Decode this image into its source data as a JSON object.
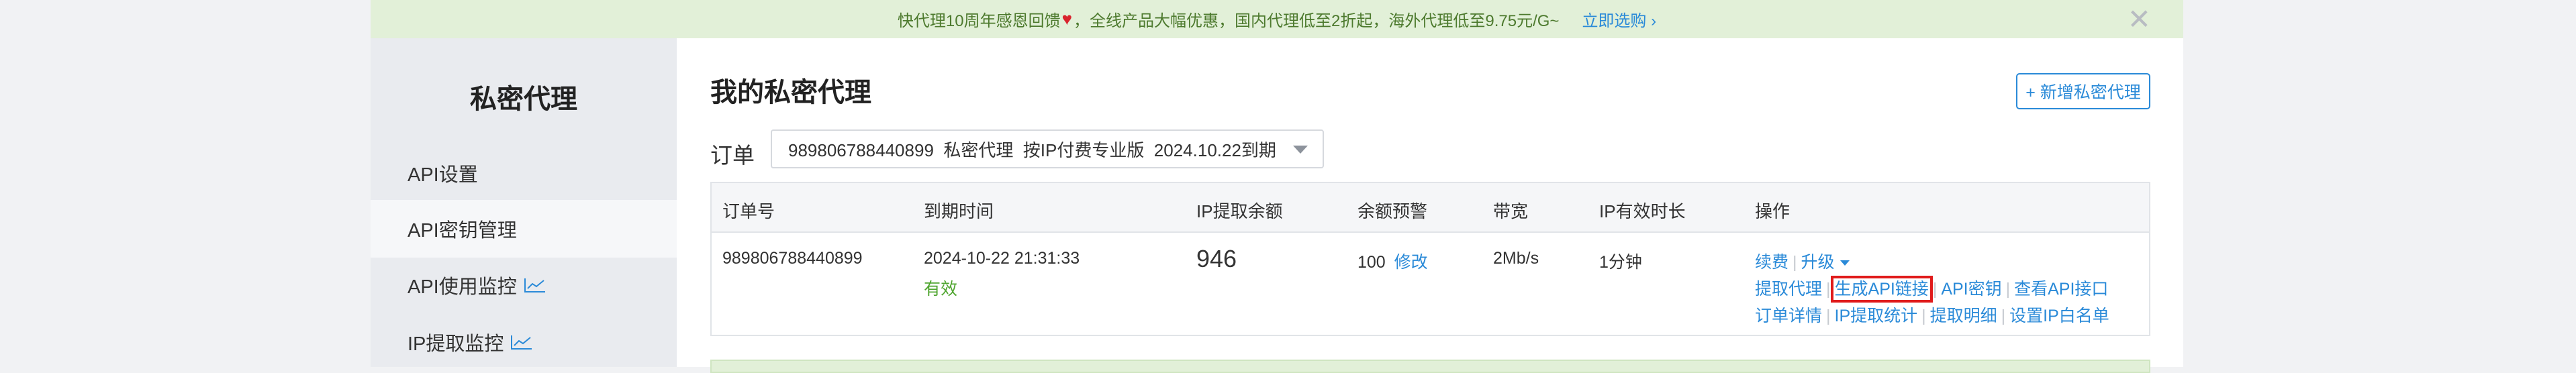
{
  "banner": {
    "text_before": "快代理10周年感恩回馈",
    "text_after": "，全线产品大幅优惠，国内代理低至2折起，海外代理低至9.75元/G~",
    "cta": "立即选购 ›",
    "close": "✕"
  },
  "sidebar": {
    "title": "私密代理",
    "items": [
      {
        "label": "API设置"
      },
      {
        "label": "API密钥管理"
      },
      {
        "label": "API使用监控"
      },
      {
        "label": "IP提取监控"
      }
    ]
  },
  "main": {
    "title": "我的私密代理",
    "add_button": "+ 新增私密代理",
    "order_label": "订单",
    "order_select": "989806788440899  私密代理  按IP付费专业版  2024.10.22到期"
  },
  "table": {
    "headers": [
      "订单号",
      "到期时间",
      "IP提取余额",
      "余额预警",
      "带宽",
      "IP有效时长",
      "操作"
    ],
    "row": {
      "order_no": "989806788440899",
      "expire_time": "2024-10-22 21:31:33",
      "status": "有效",
      "balance": "946",
      "warn_value": "100",
      "warn_edit": "修改",
      "bandwidth": "2Mb/s",
      "duration": "1分钟"
    },
    "ops": {
      "renew": "续费",
      "upgrade": "升级",
      "extract": "提取代理",
      "gen_api": "生成API链接",
      "api_key": "API密钥",
      "view_api": "查看API接口",
      "order_detail": "订单详情",
      "ip_stats": "IP提取统计",
      "extract_detail": "提取明细",
      "whitelist": "设置IP白名单"
    }
  }
}
